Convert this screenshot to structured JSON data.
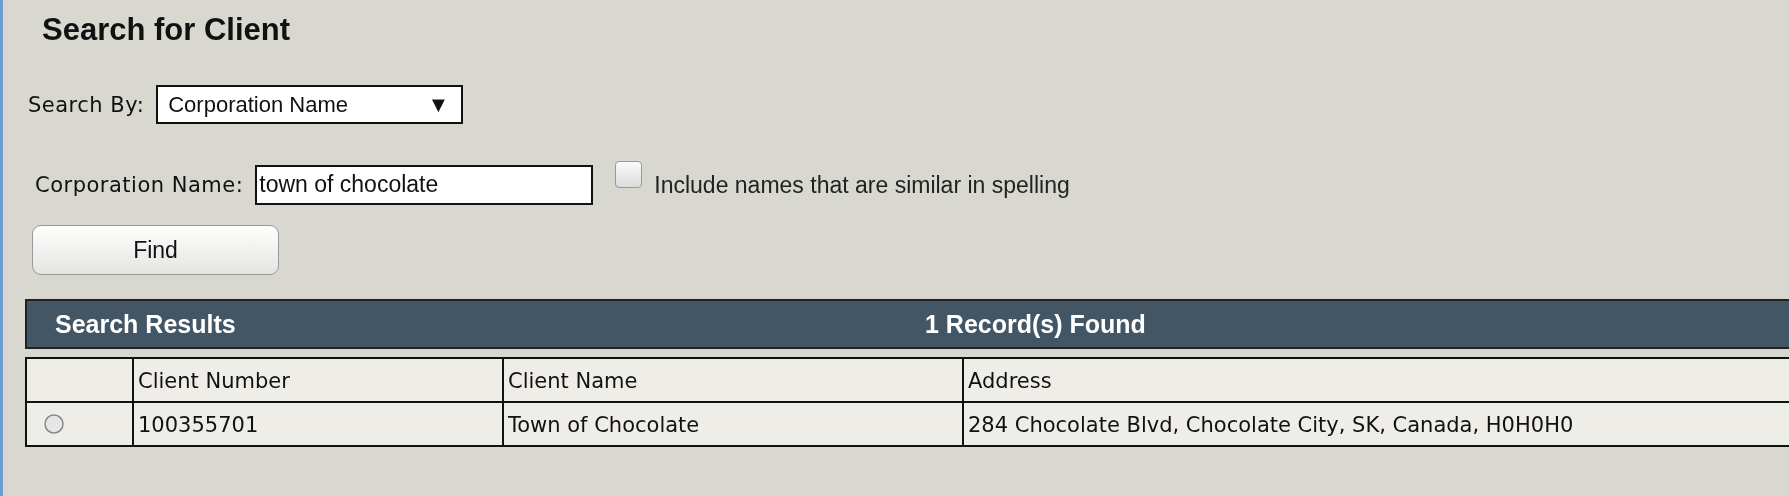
{
  "title": "Search for Client",
  "search_by": {
    "label": "Search By:",
    "value": "Corporation Name",
    "caret": "▼"
  },
  "name_field": {
    "label": "Corporation Name:",
    "value": "town of chocolate"
  },
  "similar_option": {
    "label": "Include names that are similar in spelling",
    "checked": false
  },
  "find_button": "Find",
  "results": {
    "title": "Search Results",
    "count": "1 Record(s) Found",
    "columns": [
      "Client Number",
      "Client Name",
      "Address"
    ],
    "rows": [
      {
        "selected": false,
        "cells": [
          "100355701",
          "Town of Chocolate",
          "284 Chocolate Blvd, Chocolate City, SK, Canada, H0H0H0"
        ]
      }
    ]
  }
}
